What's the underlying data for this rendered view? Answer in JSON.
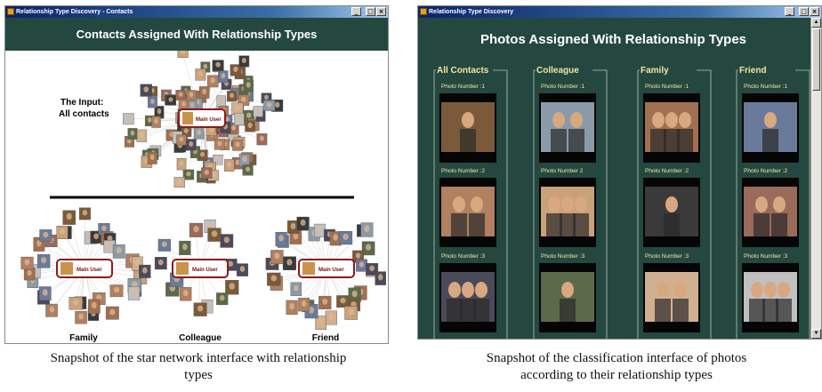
{
  "left_window": {
    "title": "Relationship Type Discovery - Contacts",
    "header": "Contacts Assigned With Relationship Types",
    "input_label_line1": "The Input:",
    "input_label_line2": "All contacts",
    "center_node_label": "Main User",
    "clusters": [
      {
        "label": "Family",
        "node_label": "Main User"
      },
      {
        "label": "Colleague",
        "node_label": "Main User"
      },
      {
        "label": "Friend",
        "node_label": "Main User"
      }
    ],
    "window_buttons": [
      "_",
      "□",
      "×"
    ]
  },
  "right_window": {
    "title": "Relationship Type Discovery",
    "header": "Photos Assigned With Relationship Types",
    "groups": [
      {
        "title": "All Contacts",
        "photos": [
          "Photo Number :1",
          "Photo Number :2",
          "Photo Number :3"
        ]
      },
      {
        "title": "Colleague",
        "photos": [
          "Photo Number :1",
          "Photo Number 2",
          "Photo Number :3"
        ]
      },
      {
        "title": "Family",
        "photos": [
          "Photo Number :1",
          "Photo Number :2",
          "Photo Number :3"
        ]
      },
      {
        "title": "Friend",
        "photos": [
          "Photo Number :1",
          "Photo Number :2",
          "Photo Number :3"
        ]
      }
    ],
    "window_buttons": [
      "_",
      "□",
      "×"
    ],
    "scroll_arrows": [
      "▲",
      "▼"
    ]
  },
  "captions": {
    "left_line1": "Snapshot of the star network interface with relationship",
    "left_line2": "types",
    "right_line1": "Snapshot of the classification interface of photos",
    "right_line2": "according to their relationship types"
  },
  "colors": {
    "window_bg": "#244840",
    "title_text": "#f2e6a0",
    "main_user_border": "#8b1a1a"
  }
}
